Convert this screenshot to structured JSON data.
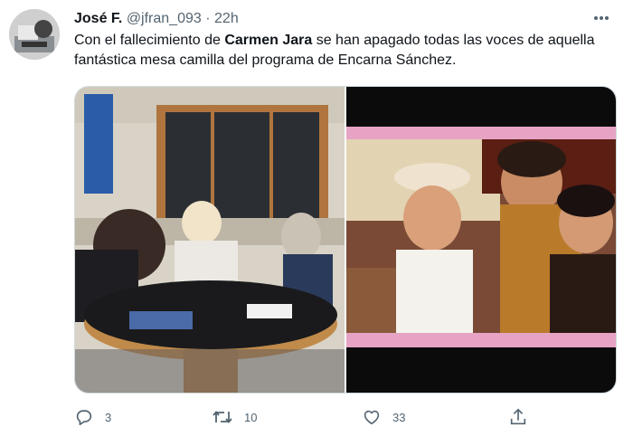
{
  "tweet": {
    "author_name": "José F.",
    "handle": "@jfran_093",
    "separator": "·",
    "time": "22h",
    "text_before": "Con el fallecimiento de ",
    "text_bold": "Carmen Jara",
    "text_after": " se han apagado todas las voces de aquella fantástica mesa camilla del programa de Encarna Sánchez."
  },
  "media": {
    "left_photo": "radio-studio-round-table-photo",
    "right_photo": "three-women-smiling-photo"
  },
  "actions": {
    "reply_count": "3",
    "retweet_count": "10",
    "like_count": "33"
  },
  "icons": {
    "more": "more-icon",
    "reply": "reply-icon",
    "retweet": "retweet-icon",
    "like": "heart-icon",
    "share": "share-icon"
  },
  "colors": {
    "text_primary": "#0f1419",
    "text_secondary": "#536471",
    "border": "#cfd9de",
    "pink_band": "#e7a3c4"
  }
}
